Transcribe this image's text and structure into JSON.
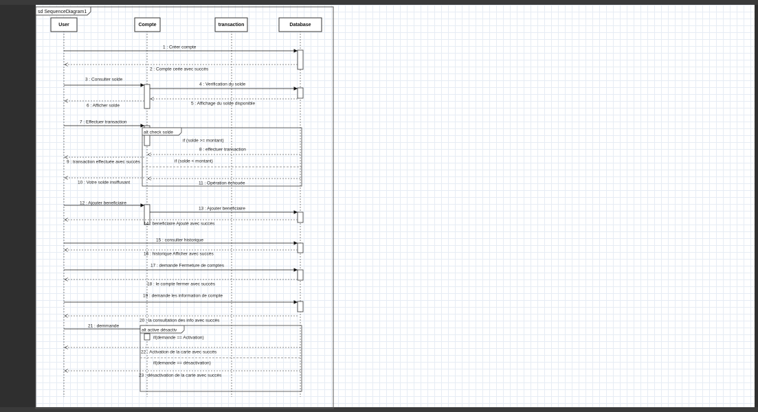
{
  "frame": {
    "title": "sd SequenceDiagram1"
  },
  "lifelines": [
    {
      "id": "user",
      "name": "User"
    },
    {
      "id": "compte",
      "name": "Compte"
    },
    {
      "id": "transaction",
      "name": "transaction"
    },
    {
      "id": "database",
      "name": "Database"
    }
  ],
  "fragments": [
    {
      "id": "alt1",
      "title": "alt check solde",
      "guards": [
        "if  (solde >= montant)",
        "if  (solde < montant)"
      ]
    },
    {
      "id": "alt2",
      "title": "alt active désactiv",
      "guards": [
        "if(demande == Activation)",
        "if(demande == désactivation)"
      ]
    }
  ],
  "messages": [
    {
      "from": "user",
      "to": "database",
      "label": "1 : Créer compte",
      "type": "sync"
    },
    {
      "from": "database",
      "to": "user",
      "label": "2 : Compte ceée avec succès",
      "type": "reply"
    },
    {
      "from": "user",
      "to": "compte",
      "label": "3 : Consulter solde",
      "type": "sync"
    },
    {
      "from": "compte",
      "to": "database",
      "label": "4 : Verification du solde",
      "type": "sync"
    },
    {
      "from": "database",
      "to": "compte",
      "label": "5 : Affichage du solde disponible",
      "type": "reply"
    },
    {
      "from": "compte",
      "to": "user",
      "label": "6 : Afficher solde",
      "type": "reply"
    },
    {
      "from": "user",
      "to": "compte",
      "label": "7 : Effectuer transaction",
      "type": "sync"
    },
    {
      "from": "database",
      "to": "compte",
      "label": "8 : effectuer transaction",
      "type": "reply"
    },
    {
      "from": "compte",
      "to": "user",
      "label": "9 : transaction effectuée avec succès",
      "type": "reply"
    },
    {
      "from": "compte",
      "to": "user",
      "label": "10 : Votre solde insiffusant",
      "type": "reply"
    },
    {
      "from": "database",
      "to": "compte",
      "label": "11 : Opération échouée",
      "type": "reply"
    },
    {
      "from": "user",
      "to": "compte",
      "label": "12 : Ajouter beneficiaire",
      "type": "sync"
    },
    {
      "from": "compte",
      "to": "database",
      "label": "13 : Ajouter beneficiaire",
      "type": "sync"
    },
    {
      "from": "database",
      "to": "user",
      "label": "14 : beneficiaire Ajouté avec succès",
      "type": "reply"
    },
    {
      "from": "user",
      "to": "database",
      "label": "15 : consulter historique",
      "type": "sync"
    },
    {
      "from": "database",
      "to": "user",
      "label": "16 : historique Afficher avec succès",
      "type": "reply"
    },
    {
      "from": "user",
      "to": "database",
      "label": "17 : demande Fermeture de comptes",
      "type": "sync"
    },
    {
      "from": "database",
      "to": "user",
      "label": "18 : le compte fermer avec succès",
      "type": "reply"
    },
    {
      "from": "user",
      "to": "database",
      "label": "19 : demande les information de compte",
      "type": "sync"
    },
    {
      "from": "database",
      "to": "user",
      "label": "20 : la consultation des info avec succès",
      "type": "reply"
    },
    {
      "from": "user",
      "to": "compte",
      "label": "21 : demmande",
      "type": "sync"
    },
    {
      "from": "database",
      "to": "user",
      "label": "22 : Activation de la carte  avec succès",
      "type": "reply"
    },
    {
      "from": "database",
      "to": "user",
      "label": "23 : désactivation de la carte avec succès",
      "type": "reply"
    }
  ]
}
